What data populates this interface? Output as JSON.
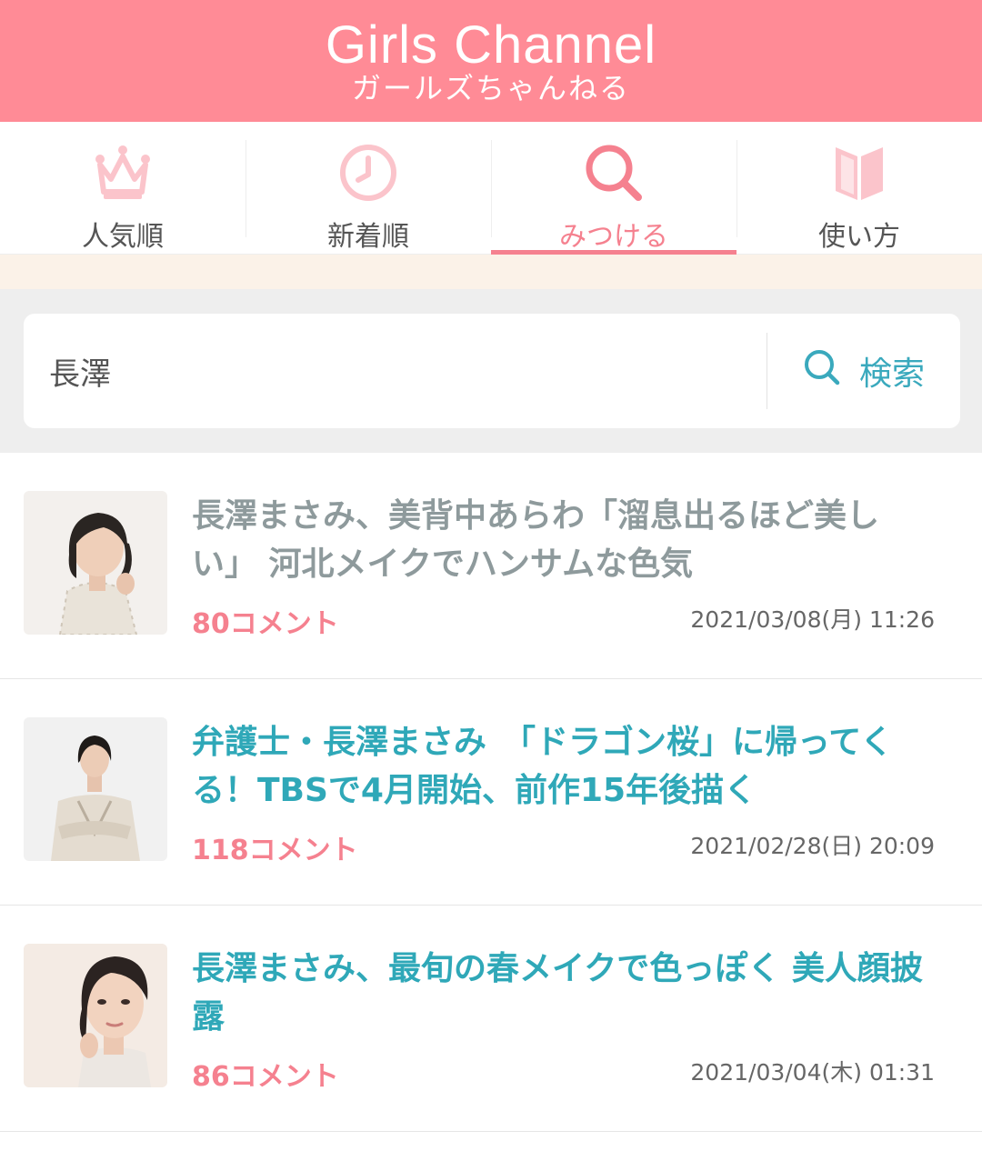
{
  "header": {
    "logo_en": "Girls Channel",
    "logo_ja": "ガールズちゃんねる"
  },
  "nav": [
    {
      "label": "人気順",
      "icon": "crown-icon"
    },
    {
      "label": "新着順",
      "icon": "clock-icon"
    },
    {
      "label": "みつける",
      "icon": "search-icon",
      "active": true
    },
    {
      "label": "使い方",
      "icon": "book-icon"
    }
  ],
  "search": {
    "value": "長澤",
    "button_label": "検索"
  },
  "topics": [
    {
      "title": "長澤まさみ、美背中あらわ「溜息出るほど美しい」 河北メイクでハンサムな色気",
      "comments": "80コメント",
      "date": "2021/03/08(月) 11:26",
      "visited": true
    },
    {
      "title": "弁護士・長澤まさみ　「ドラゴン桜」に帰ってくる！TBSで4月開始、前作15年後描く",
      "comments": "118コメント",
      "date": "2021/02/28(日) 20:09",
      "visited": false
    },
    {
      "title": "長澤まさみ、最旬の春メイクで色っぽく 美人顔披露",
      "comments": "86コメント",
      "date": "2021/03/04(木) 01:31",
      "visited": false
    }
  ],
  "colors": {
    "brand_pink": "#ff8b96",
    "accent_pink": "#f5818f",
    "link_teal": "#2fa8b8",
    "visited_gray": "#8e9a9c"
  }
}
